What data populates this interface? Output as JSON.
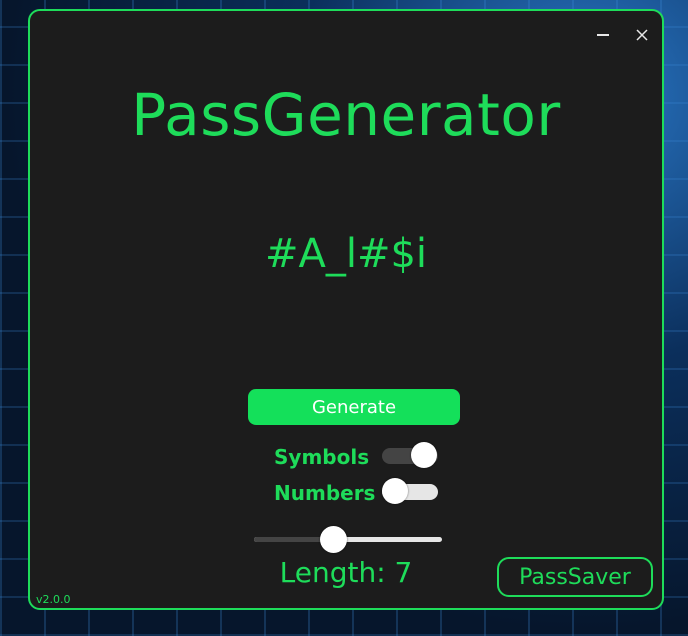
{
  "window": {
    "title": "PassGenerator",
    "minimize_icon": "minimize-icon",
    "close_icon": "close-icon"
  },
  "password": "#A_l#$i",
  "generate_label": "Generate",
  "options": {
    "symbols": {
      "label": "Symbols",
      "enabled": true
    },
    "numbers": {
      "label": "Numbers",
      "enabled": false
    }
  },
  "length": {
    "label": "Length:",
    "value": "7",
    "slider_fraction": 0.42
  },
  "passsaver_label": "PassSaver",
  "version": "v2.0.0",
  "colors": {
    "accent": "#1edc5a",
    "button": "#14e05a",
    "window_bg": "#1c1c1c"
  }
}
